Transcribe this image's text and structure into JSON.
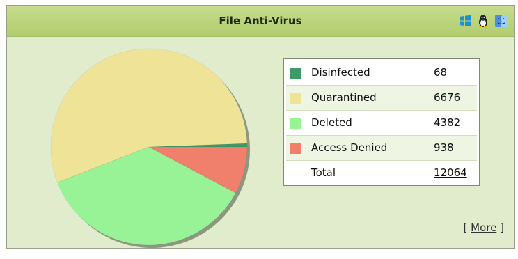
{
  "widget": {
    "title": "File Anti-Virus",
    "os_icons": [
      "windows-icon",
      "linux-icon",
      "mac-finder-icon"
    ],
    "more": {
      "open": "[",
      "label": "More",
      "close": "]"
    }
  },
  "legend": {
    "rows": [
      {
        "label": "Disinfected",
        "value": "68",
        "color": "#3f9a68"
      },
      {
        "label": "Quarantined",
        "value": "6676",
        "color": "#efe398"
      },
      {
        "label": "Deleted",
        "value": "4382",
        "color": "#98f296"
      },
      {
        "label": "Access Denied",
        "value": "938",
        "color": "#f07f6c"
      },
      {
        "label": "Total",
        "value": "12064"
      }
    ]
  },
  "chart_data": {
    "type": "pie",
    "categories": [
      "Disinfected",
      "Quarantined",
      "Deleted",
      "Access Denied"
    ],
    "values": [
      68,
      6676,
      4382,
      938
    ],
    "colors": [
      "#3f9a68",
      "#efe398",
      "#98f296",
      "#f07f6c"
    ],
    "title": ""
  }
}
